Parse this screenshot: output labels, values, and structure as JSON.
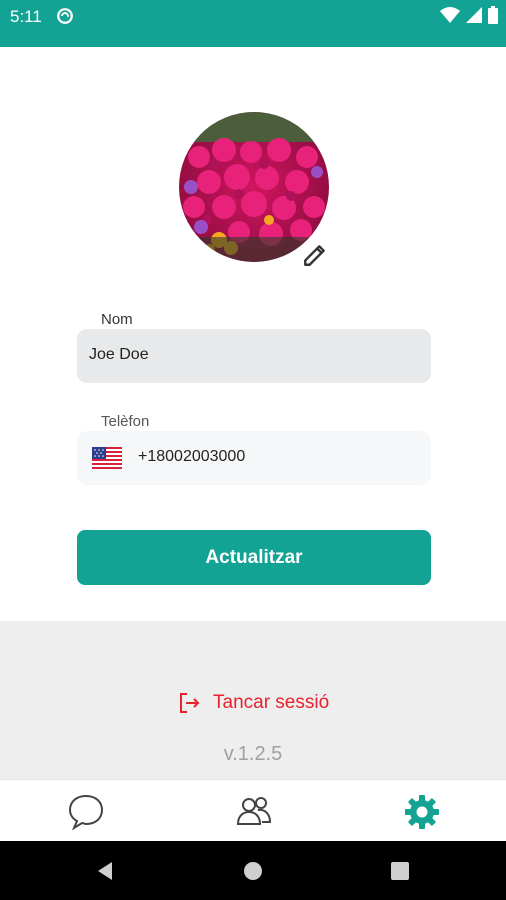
{
  "status_bar": {
    "time": "5:11",
    "icons": [
      "sync-icon",
      "wifi-icon",
      "signal-icon",
      "battery-icon"
    ],
    "color": "#13a394"
  },
  "profile": {
    "avatar_icon": "flower-photo",
    "edit_icon": "pencil-icon"
  },
  "form": {
    "name_label": "Nom",
    "name_value": "Joe Doe",
    "phone_label": "Telèfon",
    "phone_flag": "us-flag-icon",
    "phone_value": "+18002003000",
    "update_label": "Actualitzar"
  },
  "footer": {
    "logout_label": "Tancar sessió",
    "logout_color": "#e8232e",
    "version": "v.1.2.5"
  },
  "bottom_nav": {
    "items": [
      {
        "icon": "chat-icon",
        "active": false
      },
      {
        "icon": "contacts-icon",
        "active": false
      },
      {
        "icon": "settings-icon",
        "active": true
      }
    ],
    "accent": "#13a394"
  }
}
